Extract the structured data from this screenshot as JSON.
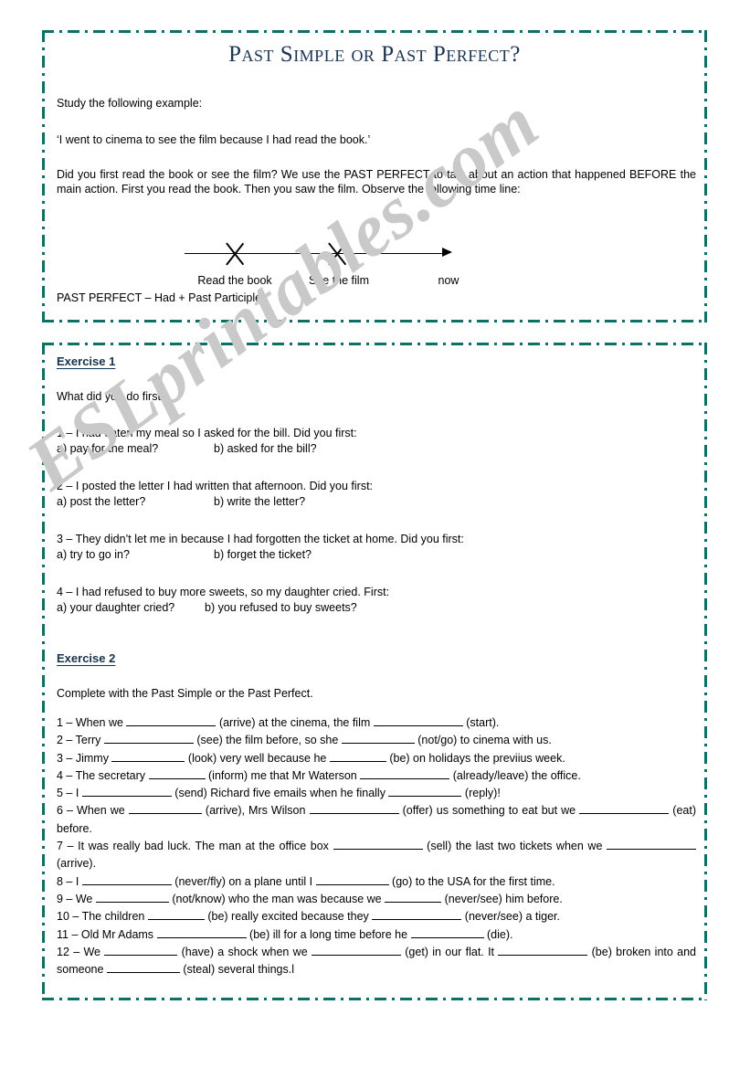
{
  "document": {
    "title": "Past Simple or Past Perfect?",
    "watermark": "ESLprintables.com",
    "accent_color": "#0d7068",
    "title_color": "#1b3554",
    "heading_color": "#16324f"
  },
  "intro": {
    "study_line": "Study the following example:",
    "example": "‘I went to cinema to see the film because I had read the book.’",
    "explanation": "Did you first read the book or see the film? We use the PAST PERFECT to talk about an action that happened BEFORE the main action. First you read the book. Then you saw the film. Observe the following time line:",
    "rule": "PAST PERFECT – Had + Past Participle"
  },
  "timeline": {
    "marker_1": "Read the book",
    "marker_2": "See the film",
    "marker_3": "now"
  },
  "exercise1": {
    "heading": "Exercise 1",
    "instruction": "What did you do first?",
    "items": [
      {
        "stem": "1 – I had eaten my meal so I asked for the bill. Did you first:",
        "a": "a) pay for the meal?",
        "b": "b) asked for the bill?"
      },
      {
        "stem": "2 – I posted the letter I had written that afternoon. Did you first:",
        "a": "a) post the letter?",
        "b": "b) write the letter?"
      },
      {
        "stem": "3 – They didn’t let me in because I had forgotten the ticket at home. Did you first:",
        "a": "a) try to go in?",
        "b": "b) forget the ticket?"
      },
      {
        "stem": "4 – I had refused to buy more sweets, so my daughter cried. First:",
        "a": "a) your daughter cried?",
        "b": "b) you refused to buy sweets?"
      }
    ]
  },
  "exercise2": {
    "heading": "Exercise 2",
    "instruction": "Complete with the Past Simple or the Past Perfect.",
    "items": [
      {
        "number": "1 –",
        "segments": [
          "When we",
          "(arrive) at the cinema, the film",
          "(start)."
        ]
      },
      {
        "number": "2 –",
        "segments": [
          "Terry",
          "(see) the film before, so she",
          "(not/go) to cinema with us."
        ]
      },
      {
        "number": "3 –",
        "segments": [
          "Jimmy",
          "(look) very well because he",
          "(be) on holidays the previius week."
        ]
      },
      {
        "number": "4 –",
        "segments": [
          "The secretary",
          "(inform) me that Mr Waterson",
          "(already/leave) the office."
        ]
      },
      {
        "number": "5 –",
        "segments": [
          "I",
          "(send) Richard five emails when he finally",
          "(reply)!"
        ]
      },
      {
        "number": "6 –",
        "segments": [
          "When we",
          "(arrive), Mrs Wilson",
          "(offer) us something to eat but we",
          "(eat) before."
        ]
      },
      {
        "number": "7 –",
        "segments": [
          "It was really bad luck. The man at the office box",
          "(sell) the last two tickets when we",
          "(arrive)."
        ]
      },
      {
        "number": "8 –",
        "segments": [
          "I",
          "(never/fly) on a plane until I",
          "(go) to the USA for the first time."
        ]
      },
      {
        "number": "9 –",
        "segments": [
          "We",
          "(not/know) who the man was because we",
          "(never/see) him before."
        ]
      },
      {
        "number": "10 –",
        "segments": [
          "The children",
          "(be) really excited because they",
          "(never/see) a tiger."
        ]
      },
      {
        "number": "11 –",
        "segments": [
          "Old Mr Adams",
          "(be) ill for a long time before he",
          "(die)."
        ]
      },
      {
        "number": "12 –",
        "segments": [
          "We",
          "(have) a shock when we",
          "(get) in our flat. It",
          "(be) broken into and someone",
          "(steal) several things.l"
        ]
      }
    ]
  }
}
